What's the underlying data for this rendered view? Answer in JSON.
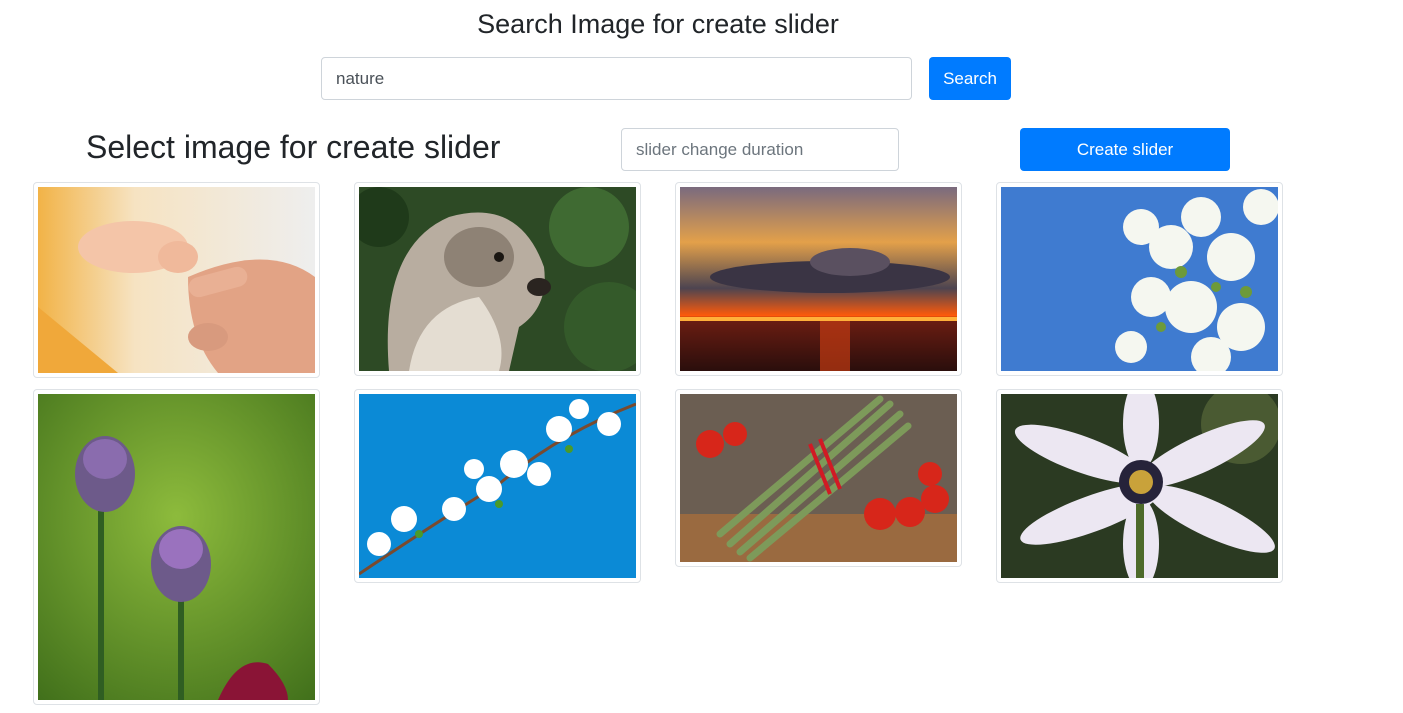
{
  "header": {
    "title": "Search Image for create slider"
  },
  "search": {
    "value": "nature",
    "button_label": "Search"
  },
  "slider": {
    "title": "Select image for create slider",
    "duration_placeholder": "slider change duration",
    "create_label": "Create slider"
  },
  "gallery": {
    "images": [
      {
        "subject": "baby-hand-holding-finger"
      },
      {
        "subject": "terrier-dog"
      },
      {
        "subject": "sunset-over-sea"
      },
      {
        "subject": "white-blossoms-blue-sky"
      },
      {
        "subject": "purple-allium-flowers"
      },
      {
        "subject": "cherry-blossom-branch"
      },
      {
        "subject": "asparagus-and-tomatoes"
      },
      {
        "subject": "white-daisy"
      }
    ]
  },
  "colors": {
    "primary": "#007bff",
    "border": "#dee2e6"
  }
}
